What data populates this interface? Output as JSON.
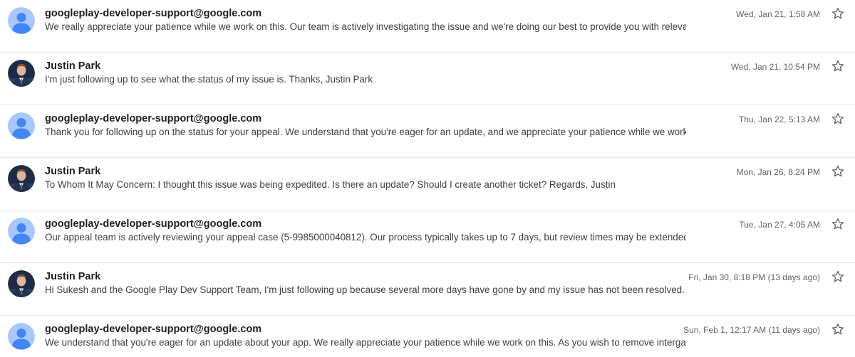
{
  "colors": {
    "avatar_default_bg": "#a8c7fa",
    "avatar_default_fg": "#4285f4",
    "star_outline": "#5f6368"
  },
  "messages": [
    {
      "avatar": "default-person-icon",
      "sender": "googleplay-developer-support@google.com",
      "snippet": "We really appreciate your patience while we work on this. Our team is actively investigating the issue and we're doing our best to provide you with relevant inf",
      "date": "Wed, Jan 21, 1:58 AM"
    },
    {
      "avatar": "profile-photo",
      "sender": "Justin Park",
      "snippet": "I'm just following up to see what the status of my issue is. Thanks, Justin Park",
      "date": "Wed, Jan 21, 10:54 PM"
    },
    {
      "avatar": "default-person-icon",
      "sender": "googleplay-developer-support@google.com",
      "snippet": "Thank you for following up on the status for your appeal. We understand that you're eager for an update, and we appreciate your patience while we work to comple",
      "date": "Thu, Jan 22, 5:13 AM"
    },
    {
      "avatar": "profile-photo",
      "sender": "Justin Park",
      "snippet": "To Whom It May Concern: I thought this issue was being expedited. Is there an update? Should I create another ticket? Regards, Justin",
      "date": "Mon, Jan 26, 8:24 PM"
    },
    {
      "avatar": "default-person-icon",
      "sender": "googleplay-developer-support@google.com",
      "snippet": "Our appeal team is actively reviewing your appeal case (5-9985000040812). Our process typically takes up to 7 days, but review times may be extended based on th",
      "date": "Tue, Jan 27, 4:05 AM"
    },
    {
      "avatar": "profile-photo",
      "sender": "Justin Park",
      "snippet": "Hi Sukesh and the Google Play Dev Support Team, I'm just following up because several more days have gone by and my issue has not been resolved. Can you please",
      "date": "Fri, Jan 30, 8:18 PM (13 days ago)"
    },
    {
      "avatar": "default-person-icon",
      "sender": "googleplay-developer-support@google.com",
      "snippet": "We understand that you're eager for an update about your app. We really appreciate your patience while we work on this. As you wish to remove intergalactic.func",
      "date": "Sun, Feb 1, 12:17 AM (11 days ago)"
    }
  ]
}
